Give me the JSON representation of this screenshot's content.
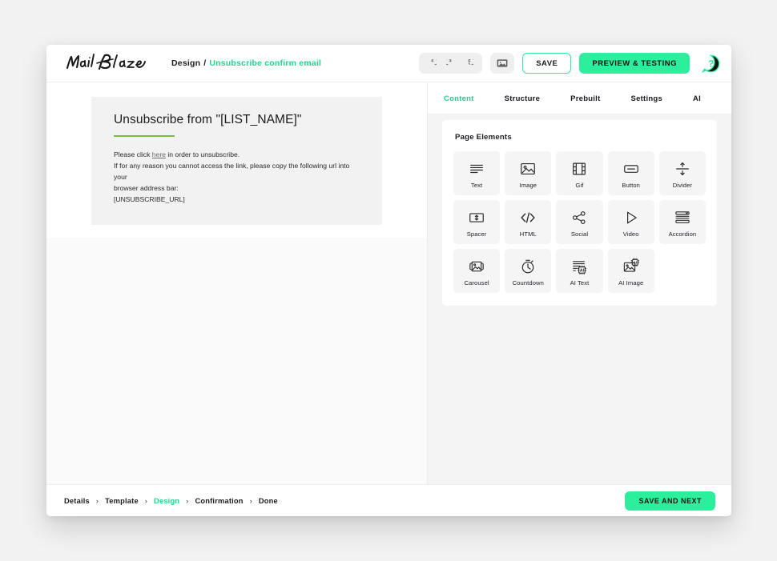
{
  "app": {
    "logo_text": "MailBlaze",
    "accent_green": "#2bef9d",
    "accent_green_text": "#18dc8d"
  },
  "header": {
    "breadcrumb_section": "Design",
    "breadcrumb_separator": "/",
    "breadcrumb_current": "Unsubscribe confirm email",
    "undo_icon": "undo-icon",
    "redo_icon": "redo-icon",
    "history_icon": "history-icon",
    "image_icon": "image-manager-icon",
    "save_label": "SAVE",
    "preview_label": "PREVIEW & TESTING",
    "help_icon": "help-icon"
  },
  "canvas": {
    "email": {
      "title": "Unsubscribe from \"[LIST_NAME]\"",
      "line1_prefix": "Please click ",
      "line1_link": "here",
      "line1_suffix": " in order to unsubscribe.",
      "line2": "If for any reason you cannot access the link, please copy the following url into your",
      "line3": "browser address bar:",
      "line4": "[UNSUBSCRIBE_URL]"
    }
  },
  "panel": {
    "tabs": [
      {
        "label": "Content",
        "active": true
      },
      {
        "label": "Structure",
        "active": false
      },
      {
        "label": "Prebuilt",
        "active": false
      },
      {
        "label": "Settings",
        "active": false
      },
      {
        "label": "AI",
        "active": false
      }
    ],
    "card_title": "Page Elements",
    "elements": [
      {
        "label": "Text",
        "icon": "text-lines-icon"
      },
      {
        "label": "Image",
        "icon": "image-icon"
      },
      {
        "label": "Gif",
        "icon": "film-strip-icon"
      },
      {
        "label": "Button",
        "icon": "button-icon"
      },
      {
        "label": "Divider",
        "icon": "divider-icon"
      },
      {
        "label": "Spacer",
        "icon": "spacer-icon"
      },
      {
        "label": "HTML",
        "icon": "code-icon"
      },
      {
        "label": "Social",
        "icon": "share-icon"
      },
      {
        "label": "Video",
        "icon": "play-triangle-icon"
      },
      {
        "label": "Accordion",
        "icon": "accordion-icon"
      },
      {
        "label": "Carousel",
        "icon": "carousel-icon"
      },
      {
        "label": "Countdown",
        "icon": "stopwatch-icon"
      },
      {
        "label": "AI Text",
        "icon": "ai-text-icon"
      },
      {
        "label": "AI Image",
        "icon": "ai-image-icon"
      }
    ]
  },
  "footer": {
    "steps": [
      {
        "label": "Details",
        "active": false
      },
      {
        "label": "Template",
        "active": false
      },
      {
        "label": "Design",
        "active": true
      },
      {
        "label": "Confirmation",
        "active": false
      },
      {
        "label": "Done",
        "active": false
      }
    ],
    "separator": "›",
    "save_next_label": "SAVE AND NEXT"
  }
}
